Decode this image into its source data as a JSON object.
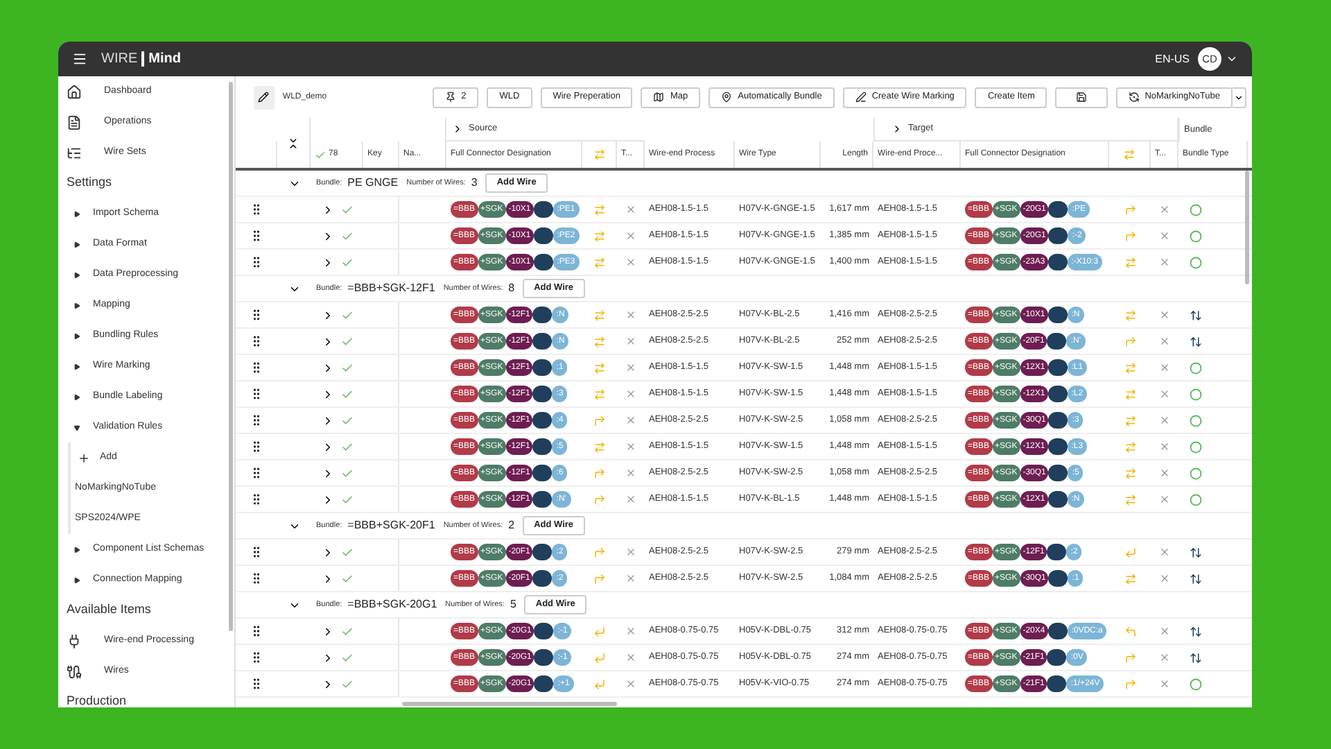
{
  "header": {
    "brand_light": "WIRE",
    "brand_bold": "Mind",
    "language": "EN-US",
    "avatar": "CD"
  },
  "sidebar": {
    "top_items": [
      {
        "label": "Dashboard"
      },
      {
        "label": "Operations"
      },
      {
        "label": "Wire Sets"
      }
    ],
    "sections": [
      {
        "title": "Settings",
        "items": [
          {
            "kind": "tree",
            "label": "Import Schema",
            "expanded": false
          },
          {
            "kind": "tree",
            "label": "Data Format",
            "expanded": false
          },
          {
            "kind": "tree",
            "label": "Data Preprocessing",
            "expanded": false
          },
          {
            "kind": "tree",
            "label": "Mapping",
            "expanded": false
          },
          {
            "kind": "tree",
            "label": "Bundling Rules",
            "expanded": false
          },
          {
            "kind": "tree",
            "label": "Wire Marking",
            "expanded": false
          },
          {
            "kind": "tree",
            "label": "Bundle Labeling",
            "expanded": false
          },
          {
            "kind": "tree",
            "label": "Validation Rules",
            "expanded": true,
            "children": [
              {
                "kind": "add",
                "label": "Add"
              },
              {
                "kind": "rule",
                "label": "NoMarkingNoTube"
              },
              {
                "kind": "rule",
                "label": "SPS2024/WPE"
              }
            ]
          },
          {
            "kind": "tree",
            "label": "Component List Schemas",
            "expanded": false
          },
          {
            "kind": "tree",
            "label": "Connection Mapping",
            "expanded": false
          }
        ]
      },
      {
        "title": "Available Items",
        "items": [
          {
            "kind": "link",
            "label": "Wire-end Processing"
          },
          {
            "kind": "link",
            "label": "Wires"
          }
        ]
      },
      {
        "title": "Production"
      }
    ]
  },
  "toolbar": {
    "title": "WLD_demo",
    "buttons": [
      {
        "kind": "pin",
        "label": "2"
      },
      {
        "kind": "text",
        "label": "WLD"
      },
      {
        "kind": "text",
        "label": "Wire Preperation"
      },
      {
        "kind": "map",
        "label": "Map"
      },
      {
        "kind": "bundle",
        "label": "Automatically Bundle"
      },
      {
        "kind": "marking",
        "label": "Create Wire Marking"
      },
      {
        "kind": "text",
        "label": "Create Item"
      },
      {
        "kind": "save"
      },
      {
        "kind": "profile",
        "label": "NoMarkingNoTube"
      }
    ]
  },
  "table": {
    "groups": [
      {
        "label": "Source"
      },
      {
        "label": "Target"
      },
      {
        "label": "Bundle"
      }
    ],
    "columns": [
      {
        "kind": "check",
        "label": "78"
      },
      {
        "kind": "text",
        "label": "Key"
      },
      {
        "kind": "text",
        "label": "Na..."
      },
      {
        "kind": "text",
        "label": "Full Connector Designation"
      },
      {
        "kind": "swap"
      },
      {
        "kind": "text",
        "label": "T..."
      },
      {
        "kind": "text",
        "label": "Wire-end Process"
      },
      {
        "kind": "text",
        "label": "Wire Type"
      },
      {
        "kind": "number",
        "label": "Length"
      },
      {
        "kind": "text",
        "label": "Wire-end Proce..."
      },
      {
        "kind": "text",
        "label": "Full Connector Designation"
      },
      {
        "kind": "swap"
      },
      {
        "kind": "text",
        "label": "T..."
      },
      {
        "kind": "text",
        "label": "Bundle Type"
      }
    ],
    "bundles": [
      {
        "expanded": true,
        "label": "Bundle:",
        "name": "PE GNGE",
        "count_label": "Number of Wires:",
        "count": "3",
        "button": "Add Wire",
        "wires": [
          {
            "expanded": false,
            "valid": true,
            "source": [
              "=BBB",
              "+SGK",
              "-10X1",
              ":PE1"
            ],
            "source_turn": {
              "kind": "swap"
            },
            "source_process": "AEH08-1.5-1.5",
            "wire_type": "H07V-K-GNGE-1.5",
            "length": "1,617 mm",
            "target_process": "AEH08-1.5-1.5",
            "target": [
              "=BBB",
              "+SGK",
              "-20G1",
              ":PE"
            ],
            "target_turn": {
              "kind": "turn-right"
            },
            "bundle_type": {
              "kind": "circle"
            }
          },
          {
            "expanded": false,
            "valid": true,
            "source": [
              "=BBB",
              "+SGK",
              "-10X1",
              ":PE2"
            ],
            "source_turn": {
              "kind": "swap"
            },
            "source_process": "AEH08-1.5-1.5",
            "wire_type": "H07V-K-GNGE-1.5",
            "length": "1,385 mm",
            "target_process": "AEH08-1.5-1.5",
            "target": [
              "=BBB",
              "+SGK",
              "-20G1",
              ":-2"
            ],
            "target_turn": {
              "kind": "turn-right"
            },
            "bundle_type": {
              "kind": "circle"
            }
          },
          {
            "expanded": false,
            "valid": true,
            "source": [
              "=BBB",
              "+SGK",
              "-10X1",
              ":PE3"
            ],
            "source_turn": {
              "kind": "swap"
            },
            "source_process": "AEH08-1.5-1.5",
            "wire_type": "H07V-K-GNGE-1.5",
            "length": "1,400 mm",
            "target_process": "AEH08-1.5-1.5",
            "target": [
              "=BBB",
              "+SGK",
              "-23A3",
              ":-X10:3"
            ],
            "target_turn": {
              "kind": "swap"
            },
            "bundle_type": {
              "kind": "circle"
            }
          }
        ]
      },
      {
        "expanded": true,
        "label": "Bundle:",
        "name": "=BBB+SGK-12F1",
        "count_label": "Number of Wires:",
        "count": "8",
        "button": "Add Wire",
        "wires": [
          {
            "expanded": false,
            "valid": true,
            "source": [
              "=BBB",
              "+SGK",
              "-12F1",
              ":N"
            ],
            "source_turn": {
              "kind": "swap"
            },
            "source_process": "AEH08-2.5-2.5",
            "wire_type": "H07V-K-BL-2.5",
            "length": "1,416 mm",
            "target_process": "AEH08-2.5-2.5",
            "target": [
              "=BBB",
              "+SGK",
              "-10X1",
              ":N"
            ],
            "target_turn": {
              "kind": "swap"
            },
            "bundle_type": {
              "kind": "swap-vertical"
            }
          },
          {
            "expanded": false,
            "valid": true,
            "source": [
              "=BBB",
              "+SGK",
              "-12F1",
              ":N"
            ],
            "source_turn": {
              "kind": "swap"
            },
            "source_process": "AEH08-2.5-2.5",
            "wire_type": "H07V-K-BL-2.5",
            "length": "252 mm",
            "target_process": "AEH08-2.5-2.5",
            "target": [
              "=BBB",
              "+SGK",
              "-20F1",
              ":N'"
            ],
            "target_turn": {
              "kind": "turn-right"
            },
            "bundle_type": {
              "kind": "swap-vertical"
            }
          },
          {
            "expanded": false,
            "valid": true,
            "source": [
              "=BBB",
              "+SGK",
              "-12F1",
              ":1"
            ],
            "source_turn": {
              "kind": "swap"
            },
            "source_process": "AEH08-1.5-1.5",
            "wire_type": "H07V-K-SW-1.5",
            "length": "1,448 mm",
            "target_process": "AEH08-1.5-1.5",
            "target": [
              "=BBB",
              "+SGK",
              "-12X1",
              ":L1"
            ],
            "target_turn": {
              "kind": "swap"
            },
            "bundle_type": {
              "kind": "circle"
            }
          },
          {
            "expanded": false,
            "valid": true,
            "source": [
              "=BBB",
              "+SGK",
              "-12F1",
              ":3"
            ],
            "source_turn": {
              "kind": "swap"
            },
            "source_process": "AEH08-1.5-1.5",
            "wire_type": "H07V-K-SW-1.5",
            "length": "1,448 mm",
            "target_process": "AEH08-1.5-1.5",
            "target": [
              "=BBB",
              "+SGK",
              "-12X1",
              ":L2"
            ],
            "target_turn": {
              "kind": "swap"
            },
            "bundle_type": {
              "kind": "circle"
            }
          },
          {
            "expanded": false,
            "valid": true,
            "source": [
              "=BBB",
              "+SGK",
              "-12F1",
              ":4"
            ],
            "source_turn": {
              "kind": "turn-right"
            },
            "source_process": "AEH08-2.5-2.5",
            "wire_type": "H07V-K-SW-2.5",
            "length": "1,058 mm",
            "target_process": "AEH08-2.5-2.5",
            "target": [
              "=BBB",
              "+SGK",
              "-30Q1",
              ":3"
            ],
            "target_turn": {
              "kind": "swap"
            },
            "bundle_type": {
              "kind": "circle"
            }
          },
          {
            "expanded": false,
            "valid": true,
            "source": [
              "=BBB",
              "+SGK",
              "-12F1",
              ":5"
            ],
            "source_turn": {
              "kind": "swap"
            },
            "source_process": "AEH08-1.5-1.5",
            "wire_type": "H07V-K-SW-1.5",
            "length": "1,448 mm",
            "target_process": "AEH08-1.5-1.5",
            "target": [
              "=BBB",
              "+SGK",
              "-12X1",
              ":L3"
            ],
            "target_turn": {
              "kind": "swap"
            },
            "bundle_type": {
              "kind": "circle"
            }
          },
          {
            "expanded": false,
            "valid": true,
            "source": [
              "=BBB",
              "+SGK",
              "-12F1",
              ":6"
            ],
            "source_turn": {
              "kind": "turn-right"
            },
            "source_process": "AEH08-2.5-2.5",
            "wire_type": "H07V-K-SW-2.5",
            "length": "1,058 mm",
            "target_process": "AEH08-2.5-2.5",
            "target": [
              "=BBB",
              "+SGK",
              "-30Q1",
              ":5"
            ],
            "target_turn": {
              "kind": "swap"
            },
            "bundle_type": {
              "kind": "circle"
            }
          },
          {
            "expanded": false,
            "valid": true,
            "source": [
              "=BBB",
              "+SGK",
              "-12F1",
              ":N'"
            ],
            "source_turn": {
              "kind": "turn-right"
            },
            "source_process": "AEH08-1.5-1.5",
            "wire_type": "H07V-K-BL-1.5",
            "length": "1,448 mm",
            "target_process": "AEH08-1.5-1.5",
            "target": [
              "=BBB",
              "+SGK",
              "-12X1",
              ":N"
            ],
            "target_turn": {
              "kind": "swap"
            },
            "bundle_type": {
              "kind": "circle"
            }
          }
        ]
      },
      {
        "expanded": true,
        "label": "Bundle:",
        "name": "=BBB+SGK-20F1",
        "count_label": "Number of Wires:",
        "count": "2",
        "button": "Add Wire",
        "wires": [
          {
            "expanded": false,
            "valid": true,
            "source": [
              "=BBB",
              "+SGK",
              "-20F1",
              ":2"
            ],
            "source_turn": {
              "kind": "turn-right"
            },
            "source_process": "AEH08-2.5-2.5",
            "wire_type": "H07V-K-SW-2.5",
            "length": "279 mm",
            "target_process": "AEH08-2.5-2.5",
            "target": [
              "=BBB",
              "+SGK",
              "-12F1",
              ":2"
            ],
            "target_turn": {
              "kind": "return"
            },
            "bundle_type": {
              "kind": "swap-vertical"
            }
          },
          {
            "expanded": false,
            "valid": true,
            "source": [
              "=BBB",
              "+SGK",
              "-20F1",
              ":2"
            ],
            "source_turn": {
              "kind": "turn-right"
            },
            "source_process": "AEH08-2.5-2.5",
            "wire_type": "H07V-K-SW-2.5",
            "length": "1,084 mm",
            "target_process": "AEH08-2.5-2.5",
            "target": [
              "=BBB",
              "+SGK",
              "-30Q1",
              ":1"
            ],
            "target_turn": {
              "kind": "swap"
            },
            "bundle_type": {
              "kind": "swap-vertical"
            }
          }
        ]
      },
      {
        "expanded": true,
        "label": "Bundle:",
        "name": "=BBB+SGK-20G1",
        "count_label": "Number of Wires:",
        "count": "5",
        "button": "Add Wire",
        "wires": [
          {
            "expanded": false,
            "valid": true,
            "source": [
              "=BBB",
              "+SGK",
              "-20G1",
              ":-1"
            ],
            "source_turn": {
              "kind": "return"
            },
            "source_process": "AEH08-0.75-0.75",
            "wire_type": "H05V-K-DBL-0.75",
            "length": "312 mm",
            "target_process": "AEH08-0.75-0.75",
            "target": [
              "=BBB",
              "+SGK",
              "-20X4",
              ":0VDC:a"
            ],
            "target_turn": {
              "kind": "turn-left"
            },
            "bundle_type": {
              "kind": "swap-vertical"
            }
          },
          {
            "expanded": false,
            "valid": true,
            "source": [
              "=BBB",
              "+SGK",
              "-20G1",
              ":-1"
            ],
            "source_turn": {
              "kind": "return"
            },
            "source_process": "AEH08-0.75-0.75",
            "wire_type": "H05V-K-DBL-0.75",
            "length": "274 mm",
            "target_process": "AEH08-0.75-0.75",
            "target": [
              "=BBB",
              "+SGK",
              "-21F1",
              ":0V"
            ],
            "target_turn": {
              "kind": "turn-right"
            },
            "bundle_type": {
              "kind": "swap-vertical"
            }
          },
          {
            "expanded": false,
            "valid": true,
            "source": [
              "=BBB",
              "+SGK",
              "-20G1",
              ":+1"
            ],
            "source_turn": {
              "kind": "return"
            },
            "source_process": "AEH08-0.75-0.75",
            "wire_type": "H05V-K-VIO-0.75",
            "length": "274 mm",
            "target_process": "AEH08-0.75-0.75",
            "target": [
              "=BBB",
              "+SGK",
              "-21F1",
              ":1/+24V"
            ],
            "target_turn": {
              "kind": "turn-right"
            },
            "bundle_type": {
              "kind": "circle"
            }
          }
        ]
      }
    ]
  }
}
